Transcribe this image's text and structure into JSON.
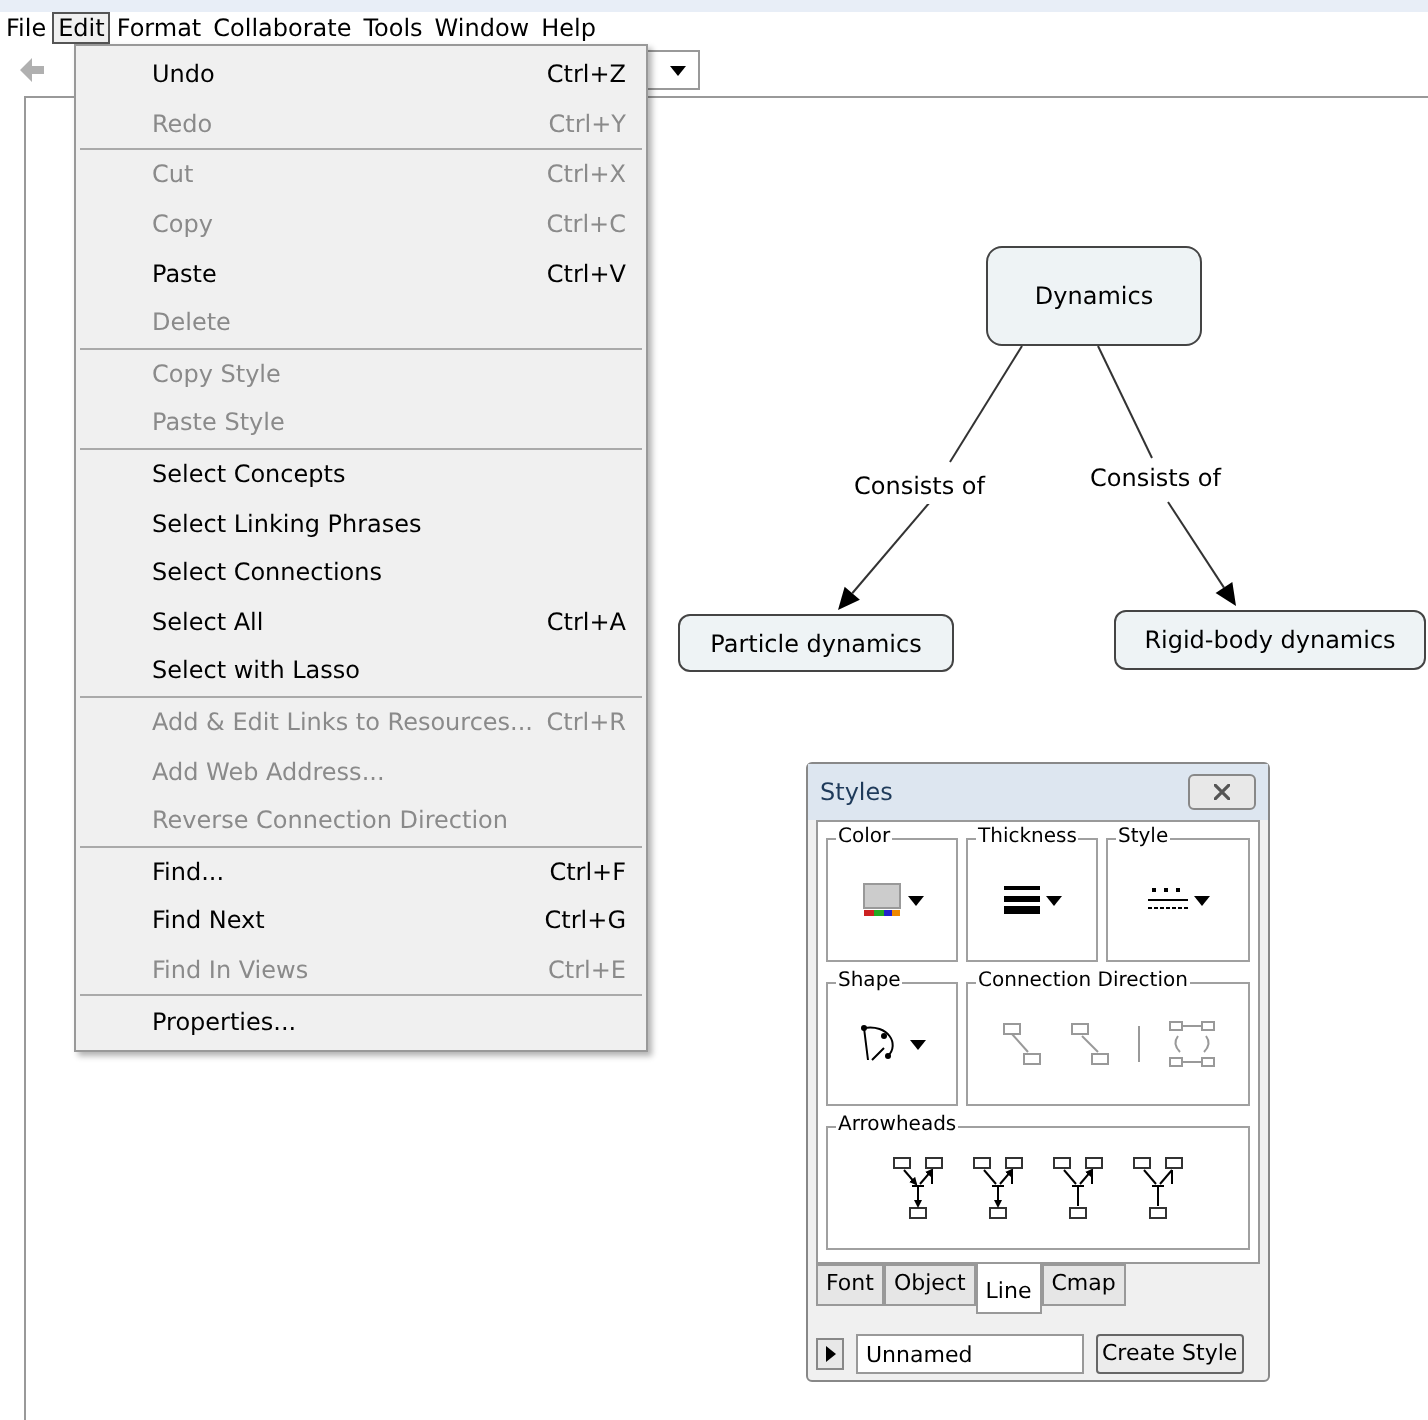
{
  "menu_bar": [
    {
      "label": "File",
      "selected": false
    },
    {
      "label": "Edit",
      "selected": true
    },
    {
      "label": "Format",
      "selected": false
    },
    {
      "label": "Collaborate",
      "selected": false
    },
    {
      "label": "Tools",
      "selected": false
    },
    {
      "label": "Window",
      "selected": false
    },
    {
      "label": "Help",
      "selected": false
    }
  ],
  "edit_menu": [
    [
      {
        "label": "Undo",
        "shortcut": "Ctrl+Z",
        "disabled": false
      },
      {
        "label": "Redo",
        "shortcut": "Ctrl+Y",
        "disabled": true
      }
    ],
    [
      {
        "label": "Cut",
        "shortcut": "Ctrl+X",
        "disabled": true
      },
      {
        "label": "Copy",
        "shortcut": "Ctrl+C",
        "disabled": true
      },
      {
        "label": "Paste",
        "shortcut": "Ctrl+V",
        "disabled": false
      },
      {
        "label": "Delete",
        "disabled": true
      }
    ],
    [
      {
        "label": "Copy Style",
        "disabled": true
      },
      {
        "label": "Paste Style",
        "disabled": true
      }
    ],
    [
      {
        "label": "Select Concepts",
        "disabled": false
      },
      {
        "label": "Select Linking Phrases",
        "disabled": false
      },
      {
        "label": "Select Connections",
        "disabled": false
      },
      {
        "label": "Select All",
        "shortcut": "Ctrl+A",
        "disabled": false
      },
      {
        "label": "Select with Lasso",
        "disabled": false
      }
    ],
    [
      {
        "label": "Add & Edit Links to Resources...",
        "shortcut": "Ctrl+R",
        "disabled": true
      },
      {
        "label": "Add Web Address...",
        "disabled": true
      },
      {
        "label": "Reverse Connection Direction",
        "disabled": true
      }
    ],
    [
      {
        "label": "Find...",
        "shortcut": "Ctrl+F",
        "disabled": false
      },
      {
        "label": "Find Next",
        "shortcut": "Ctrl+G",
        "disabled": false
      },
      {
        "label": "Find In Views",
        "shortcut": "Ctrl+E",
        "disabled": true
      }
    ],
    [
      {
        "label": "Properties...",
        "disabled": false
      }
    ]
  ],
  "concept_map": {
    "concepts": [
      {
        "label": "Dynamics"
      },
      {
        "label": "Particle dynamics"
      },
      {
        "label": "Rigid-body dynamics"
      }
    ],
    "linking_phrases": [
      {
        "label": "Consists of"
      },
      {
        "label": "Consists of"
      }
    ]
  },
  "styles_panel": {
    "title": "Styles",
    "groups": [
      {
        "label": "Color"
      },
      {
        "label": "Thickness"
      },
      {
        "label": "Style"
      },
      {
        "label": "Shape"
      },
      {
        "label": "Connection Direction"
      },
      {
        "label": "Arrowheads"
      }
    ],
    "tabs": [
      {
        "label": "Font",
        "selected": false
      },
      {
        "label": "Object",
        "selected": false
      },
      {
        "label": "Line",
        "selected": true
      },
      {
        "label": "Cmap",
        "selected": false
      }
    ],
    "style_name": {
      "value": "Unnamed"
    },
    "create_button": "Create Style"
  }
}
